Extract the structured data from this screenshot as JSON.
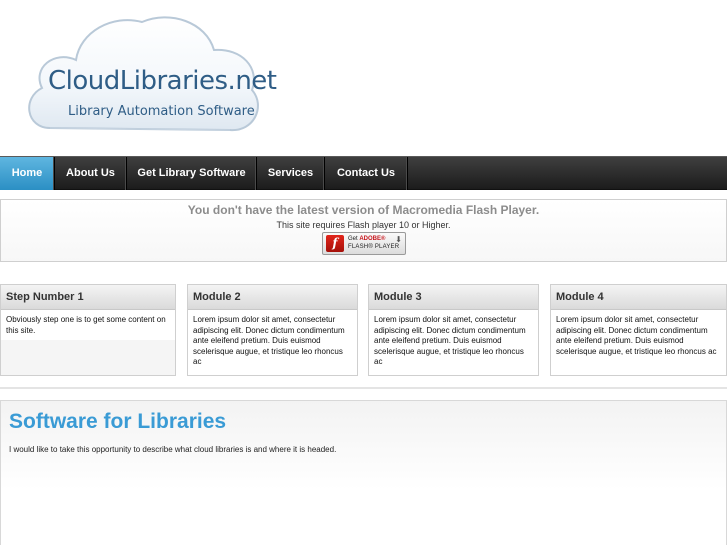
{
  "logo": {
    "title": "CloudLibraries.net",
    "subtitle": "Library Automation Software"
  },
  "nav": {
    "items": [
      {
        "label": "Home",
        "active": true
      },
      {
        "label": "About Us"
      },
      {
        "label": "Get Library Software"
      },
      {
        "label": "Services"
      },
      {
        "label": "Contact Us"
      }
    ]
  },
  "flash": {
    "title": "You don't have the latest version of Macromedia Flash Player.",
    "subtitle": "This site requires Flash player 10 or Higher.",
    "badge": {
      "logo_letter": "f",
      "get": "Get",
      "adobe": "ADOBE®",
      "player": "FLASH® PLAYER",
      "arrow": "⬇"
    }
  },
  "modules": [
    {
      "title": "Step Number 1",
      "body": "Obviously step one is to get some content on this site."
    },
    {
      "title": "Module 2",
      "body": "Lorem ipsum dolor sit amet, consectetur adipiscing elit. Donec dictum condimentum ante eleifend pretium. Duis euismod scelerisque augue, et tristique leo rhoncus ac"
    },
    {
      "title": "Module 3",
      "body": "Lorem ipsum dolor sit amet, consectetur adipiscing elit. Donec dictum condimentum ante eleifend pretium. Duis euismod scelerisque augue, et tristique leo rhoncus ac"
    },
    {
      "title": "Module 4",
      "body": "Lorem ipsum dolor sit amet, consectetur adipiscing elit. Donec dictum condimentum ante eleifend pretium. Duis euismod scelerisque augue, et tristique leo rhoncus ac"
    }
  ],
  "content": {
    "title": "Software for Libraries",
    "text": "I would like to take this opportunity to describe what cloud libraries is and where it is headed."
  },
  "colors": {
    "nav_active": "#2b8fc4",
    "heading_blue": "#3a9bd5",
    "logo_blue": "#2f5d86",
    "flash_red": "#c8161d"
  }
}
